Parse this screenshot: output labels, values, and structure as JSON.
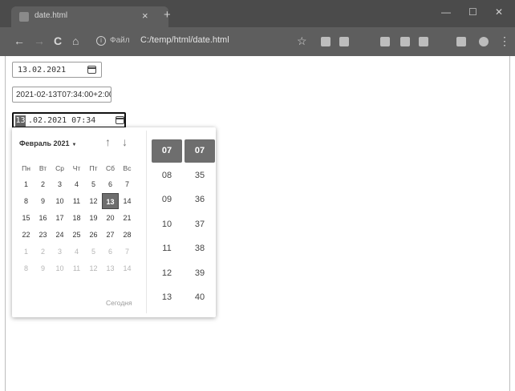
{
  "window": {
    "tab_title": "date.html",
    "tab_close": "×",
    "new_tab": "+",
    "minimize": "—",
    "maximize": "☐",
    "close": "✕"
  },
  "toolbar": {
    "back": "←",
    "forward": "→",
    "reload": "C",
    "home": "⌂",
    "info_icon": "i",
    "scheme_label": "Файл",
    "url": "C:/temp/html/date.html",
    "star": "☆"
  },
  "fields": {
    "date_value": "13.02.2021",
    "datetime_text": "2021-02-13T07:34:00+2:00",
    "datetime_local_day": "13",
    "datetime_local_rest": ".02.2021 07:34"
  },
  "picker": {
    "month_label": "Февраль 2021",
    "caret": "▼",
    "up_arrow": "↑",
    "down_arrow": "↓",
    "weekdays": [
      "Пн",
      "Вт",
      "Ср",
      "Чт",
      "Пт",
      "Сб",
      "Вс"
    ],
    "weeks": [
      [
        "1",
        "2",
        "3",
        "4",
        "5",
        "6",
        "7"
      ],
      [
        "8",
        "9",
        "10",
        "11",
        "12",
        "13",
        "14"
      ],
      [
        "15",
        "16",
        "17",
        "18",
        "19",
        "20",
        "21"
      ],
      [
        "22",
        "23",
        "24",
        "25",
        "26",
        "27",
        "28"
      ],
      [
        "1",
        "2",
        "3",
        "4",
        "5",
        "6",
        "7"
      ],
      [
        "8",
        "9",
        "10",
        "11",
        "12",
        "13",
        "14"
      ]
    ],
    "selected_day": "13",
    "today_label": "Сегодня",
    "hours": [
      "07",
      "08",
      "09",
      "10",
      "11",
      "12",
      "13"
    ],
    "minutes": [
      "07",
      "35",
      "36",
      "37",
      "38",
      "39",
      "40"
    ],
    "selected_hour": "07",
    "selected_minute": "07"
  },
  "colors": {
    "chrome_dark": "#4b4b4b",
    "selection": "#6e6e6e"
  }
}
